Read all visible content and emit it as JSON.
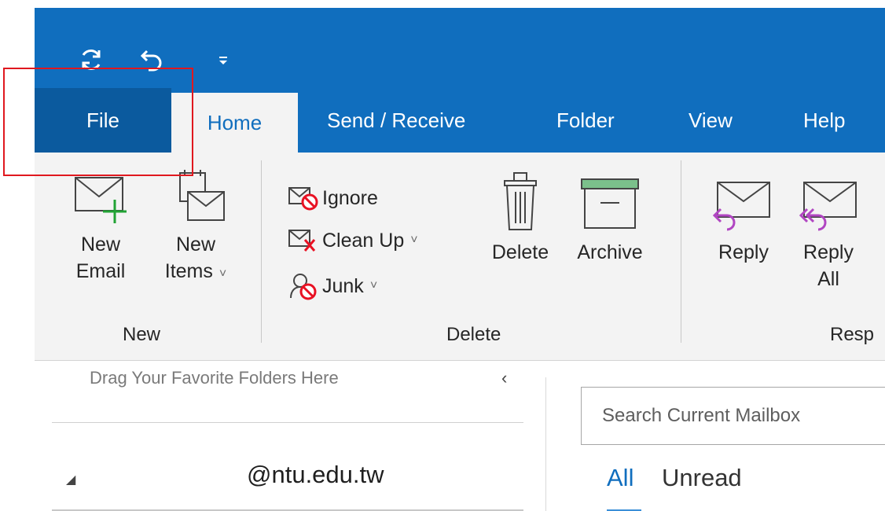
{
  "quick_access": {
    "sync_icon": "sync-icon",
    "undo_icon": "undo-icon",
    "customize_icon": "customize-toolbar-icon"
  },
  "tabs": [
    {
      "label": "File"
    },
    {
      "label": "Home"
    },
    {
      "label": "Send / Receive"
    },
    {
      "label": "Folder"
    },
    {
      "label": "View"
    },
    {
      "label": "Help"
    }
  ],
  "ribbon": {
    "new_email": {
      "line1": "New",
      "line2": "Email"
    },
    "new_items": {
      "line1": "New",
      "line2": "Items"
    },
    "ignore": "Ignore",
    "clean_up": "Clean Up",
    "junk": "Junk",
    "delete": "Delete",
    "archive": "Archive",
    "reply": "Reply",
    "reply_all": {
      "line1": "Reply",
      "line2": "All"
    },
    "groups": {
      "new": "New",
      "delete": "Delete",
      "respond": "Resp"
    }
  },
  "folders": {
    "favorites_hint": "Drag Your Favorite Folders Here",
    "collapse_icon": "chevron-left-icon",
    "account": "@ntu.edu.tw"
  },
  "mail_list": {
    "search_placeholder": "Search Current Mailbox",
    "filter_all": "All",
    "filter_unread": "Unread"
  },
  "colors": {
    "accent": "#106ebe",
    "file_tab": "#0b5a9e",
    "ribbon_bg": "#f3f3f3",
    "highlight_box": "#e0181f"
  }
}
